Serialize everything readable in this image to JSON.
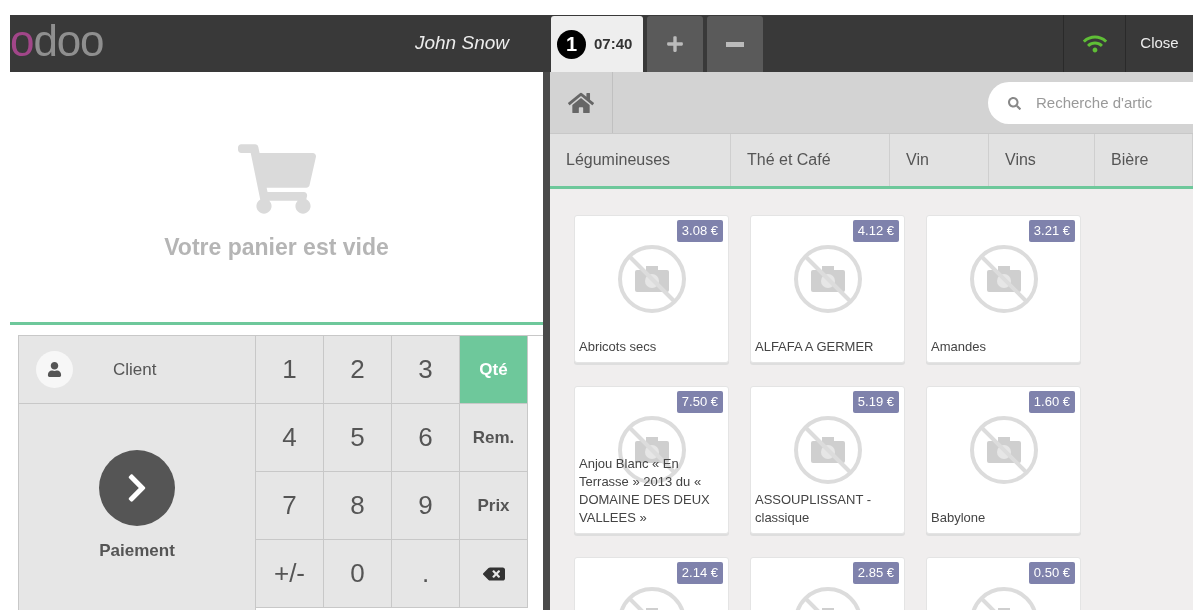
{
  "header": {
    "logo": "odoo",
    "cashier": "John Snow",
    "orders": [
      {
        "number": "1",
        "time": "07:40",
        "selected": true
      }
    ],
    "close": "Close"
  },
  "order": {
    "empty_message": "Votre panier est vide"
  },
  "pad": {
    "client": "Client",
    "payment": "Paiement",
    "keys": [
      {
        "label": "1",
        "kind": "digit"
      },
      {
        "label": "2",
        "kind": "digit"
      },
      {
        "label": "3",
        "kind": "digit"
      },
      {
        "label": "Qté",
        "kind": "mode",
        "selected": true
      },
      {
        "label": "4",
        "kind": "digit"
      },
      {
        "label": "5",
        "kind": "digit"
      },
      {
        "label": "6",
        "kind": "digit"
      },
      {
        "label": "Rem.",
        "kind": "mode",
        "selected": false
      },
      {
        "label": "7",
        "kind": "digit"
      },
      {
        "label": "8",
        "kind": "digit"
      },
      {
        "label": "9",
        "kind": "digit"
      },
      {
        "label": "Prix",
        "kind": "mode",
        "selected": false
      },
      {
        "label": "+/-",
        "kind": "digit"
      },
      {
        "label": "0",
        "kind": "digit"
      },
      {
        "label": ".",
        "kind": "digit"
      },
      {
        "kind": "backspace"
      }
    ]
  },
  "search": {
    "placeholder": "Recherche d'artic"
  },
  "categories": [
    "Légumineuses",
    "Thé et Café",
    "Vin",
    "Vins",
    "Bière"
  ],
  "products": [
    {
      "name": "Abricots secs",
      "price": "3.08 €"
    },
    {
      "name": "ALFAFA A GERMER",
      "price": "4.12 €"
    },
    {
      "name": "Amandes",
      "price": "3.21 €"
    },
    {
      "name": "Anjou Blanc « En Terrasse » 2013 du « DOMAINE DES DEUX VALLEES »",
      "price": "7.50 €"
    },
    {
      "name": "ASSOUPLISSANT - classique",
      "price": "5.19 €"
    },
    {
      "name": "Babylone",
      "price": "1.60 €"
    },
    {
      "price": "2.14 €"
    },
    {
      "price": "2.85 €"
    },
    {
      "price": "0.50 €"
    }
  ]
}
